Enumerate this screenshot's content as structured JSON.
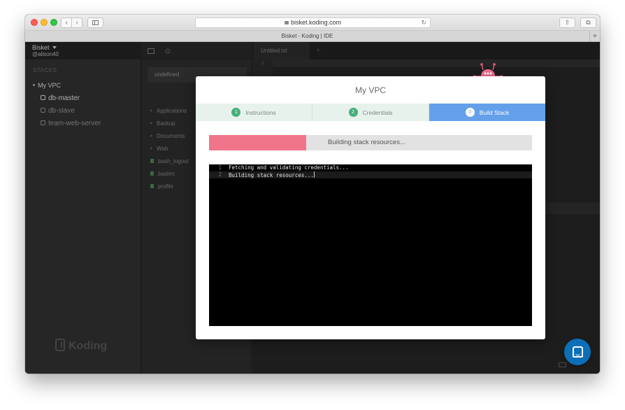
{
  "browser": {
    "url": "bisket.koding.com",
    "tab_title": "Bisket - Koding | IDE"
  },
  "team": {
    "name": "Bisket",
    "user": "@alison40"
  },
  "sidebar": {
    "section_label": "STACKS",
    "stack_name": "My VPC",
    "machines": [
      "db-master",
      "db-slave",
      "team-web-server"
    ],
    "logo_text": "Koding"
  },
  "file_panel": {
    "vm_select": "undefined",
    "folders": [
      "Applications",
      "Backup",
      "Documents",
      "Web"
    ],
    "files": [
      ".bash_logout",
      ".bashrc",
      ".profile"
    ]
  },
  "editor": {
    "tab_label": "Untitled.txt",
    "gutter_line": "1"
  },
  "modal": {
    "title": "My VPC",
    "steps": [
      {
        "num": "1",
        "label": "Instructions"
      },
      {
        "num": "2",
        "label": "Credentials"
      },
      {
        "num": "3",
        "label": "Build Stack"
      }
    ],
    "active_step": 3,
    "progress_text": "Building stack resources...",
    "progress_fraction": 0.3,
    "console_lines": [
      {
        "num": "1",
        "text": "Fetching and validating credentials..."
      },
      {
        "num": "2",
        "text": "Building stack resources..."
      }
    ]
  },
  "colors": {
    "step_active": "#64a0ea",
    "step_done_badge": "#46b07a",
    "progress_fill": "#f1758a",
    "chat_button": "#0c6fb8"
  }
}
